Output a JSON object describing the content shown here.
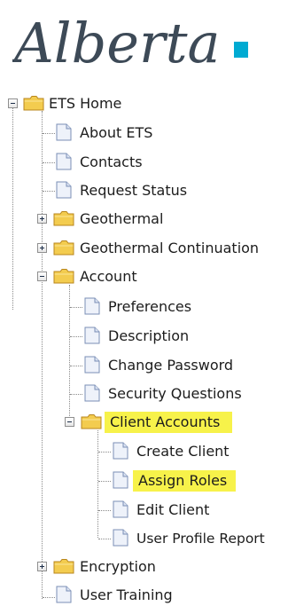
{
  "brand": {
    "logo_text": "Alberta",
    "logo_color": "#3d4a57",
    "logo_accent_color": "#00aad2"
  },
  "colors": {
    "highlight": "#f7f24a",
    "folder": "#f3cc4f",
    "page": "#eef2fa"
  },
  "tree": {
    "root": {
      "label": "ETS Home",
      "expanded": true
    },
    "items": {
      "about_ets": {
        "label": "About ETS"
      },
      "contacts": {
        "label": "Contacts"
      },
      "request_status": {
        "label": "Request Status"
      },
      "geothermal": {
        "label": "Geothermal",
        "expanded": false
      },
      "geothermal_continuation": {
        "label": "Geothermal Continuation",
        "expanded": false
      },
      "account": {
        "label": "Account",
        "expanded": true,
        "children": {
          "preferences": {
            "label": "Preferences"
          },
          "description": {
            "label": "Description"
          },
          "change_password": {
            "label": "Change Password"
          },
          "security_questions": {
            "label": "Security Questions"
          },
          "client_accounts": {
            "label": "Client Accounts",
            "expanded": true,
            "highlighted": true,
            "children": {
              "create_client": {
                "label": "Create Client"
              },
              "assign_roles": {
                "label": "Assign Roles",
                "highlighted": true
              },
              "edit_client": {
                "label": "Edit Client"
              },
              "user_profile_report": {
                "label": "User Profile Report"
              }
            }
          }
        }
      },
      "encryption": {
        "label": "Encryption",
        "expanded": false
      },
      "user_training": {
        "label": "User Training"
      }
    }
  }
}
